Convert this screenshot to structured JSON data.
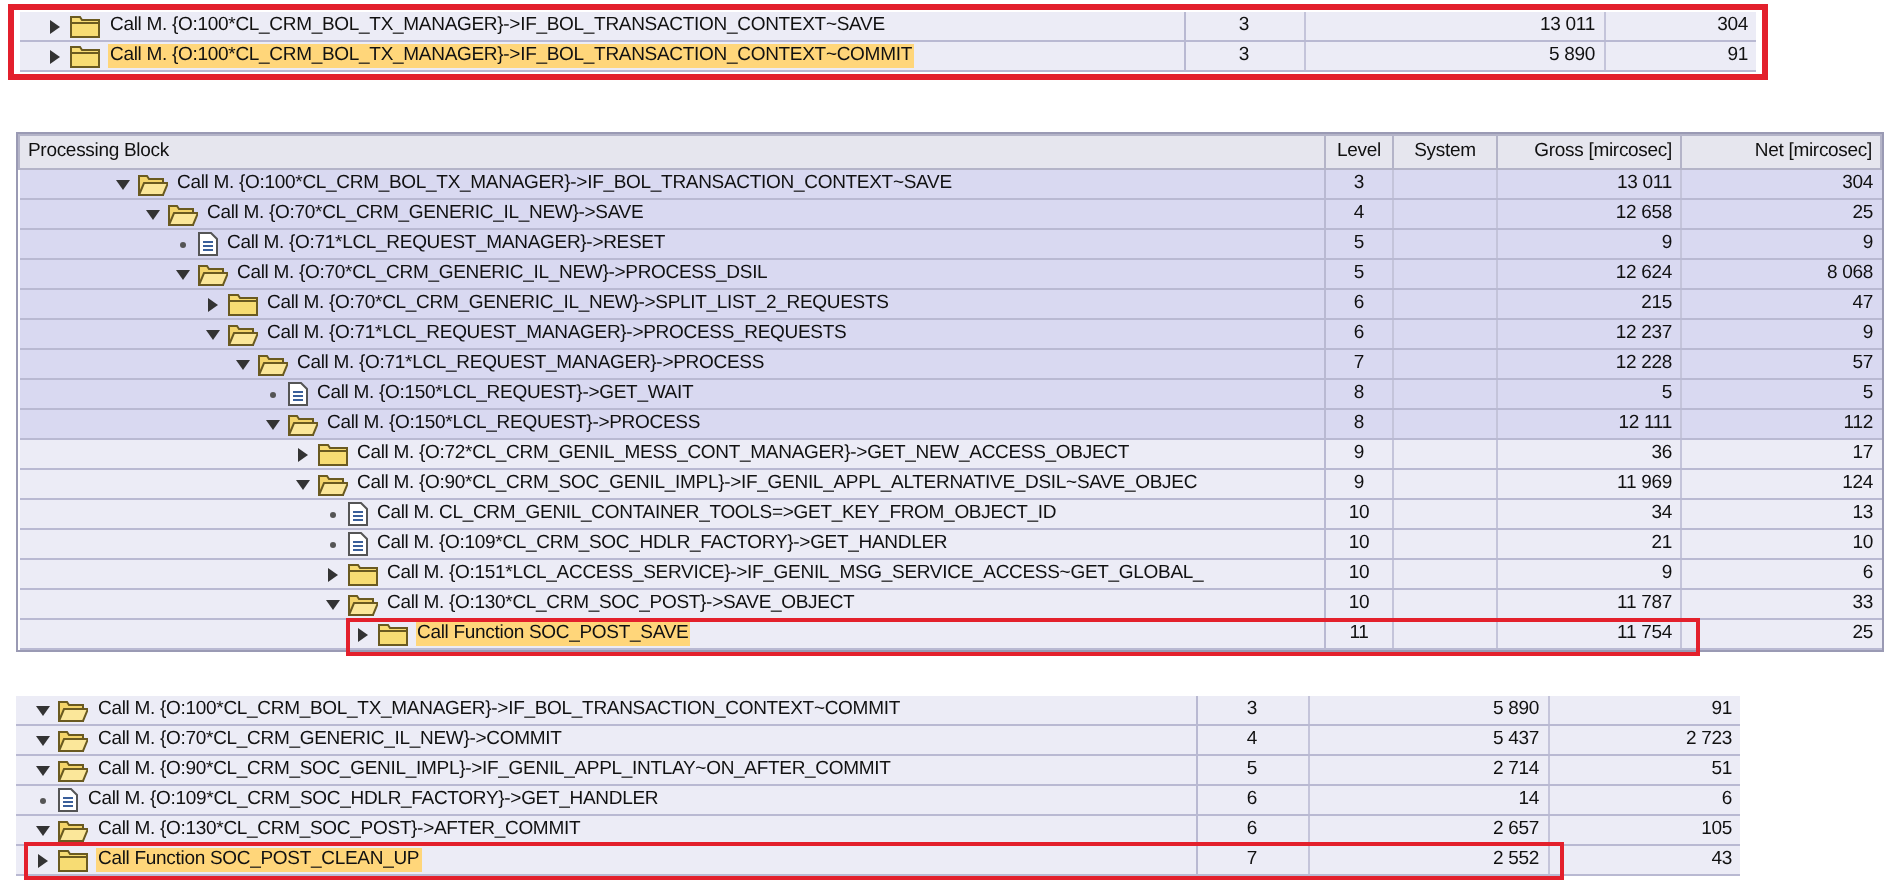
{
  "top_excerpt": {
    "framed": true,
    "rows": [
      {
        "kind": "folder",
        "expanded": false,
        "text": "Call M. {O:100*CL_CRM_BOL_TX_MANAGER}->IF_BOL_TRANSACTION_CONTEXT~SAVE",
        "level": "3",
        "gross": "13 011",
        "net": "304",
        "selected": false,
        "shaded": false,
        "framed": false
      },
      {
        "kind": "folder",
        "expanded": false,
        "text": "Call M. {O:100*CL_CRM_BOL_TX_MANAGER}->IF_BOL_TRANSACTION_CONTEXT~COMMIT",
        "level": "3",
        "gross": "5 890",
        "net": "91",
        "selected": true,
        "shaded": false,
        "framed": false
      }
    ]
  },
  "trace_table": {
    "columns": [
      "Processing Block",
      "Level",
      "System",
      "Gross [mircosec]",
      "Net [mircosec]"
    ],
    "rows": [
      {
        "kind": "folder",
        "expanded": true,
        "text": "Call M. {O:100*CL_CRM_BOL_TX_MANAGER}->IF_BOL_TRANSACTION_CONTEXT~SAVE",
        "level": "3",
        "gross": "13 011",
        "net": "304",
        "selected": false,
        "shaded": true,
        "framed": false,
        "children": [
          {
            "kind": "folder",
            "expanded": true,
            "text": "Call M. {O:70*CL_CRM_GENERIC_IL_NEW}->SAVE",
            "level": "4",
            "gross": "12 658",
            "net": "25",
            "selected": false,
            "shaded": true,
            "framed": false,
            "children": [
              {
                "kind": "document",
                "text": "Call M. {O:71*LCL_REQUEST_MANAGER}->RESET",
                "level": "5",
                "gross": "9",
                "net": "9",
                "selected": false,
                "shaded": true,
                "framed": false
              },
              {
                "kind": "folder",
                "expanded": true,
                "text": "Call M. {O:70*CL_CRM_GENERIC_IL_NEW}->PROCESS_DSIL",
                "level": "5",
                "gross": "12 624",
                "net": "8 068",
                "selected": false,
                "shaded": true,
                "framed": false,
                "children": [
                  {
                    "kind": "folder",
                    "expanded": false,
                    "text": "Call M. {O:70*CL_CRM_GENERIC_IL_NEW}->SPLIT_LIST_2_REQUESTS",
                    "level": "6",
                    "gross": "215",
                    "net": "47",
                    "selected": false,
                    "shaded": true,
                    "framed": false
                  },
                  {
                    "kind": "folder",
                    "expanded": true,
                    "text": "Call M. {O:71*LCL_REQUEST_MANAGER}->PROCESS_REQUESTS",
                    "level": "6",
                    "gross": "12 237",
                    "net": "9",
                    "selected": false,
                    "shaded": true,
                    "framed": false,
                    "children": [
                      {
                        "kind": "folder",
                        "expanded": true,
                        "text": "Call M. {O:71*LCL_REQUEST_MANAGER}->PROCESS",
                        "level": "7",
                        "gross": "12 228",
                        "net": "57",
                        "selected": false,
                        "shaded": true,
                        "framed": false,
                        "children": [
                          {
                            "kind": "document",
                            "text": "Call M. {O:150*LCL_REQUEST}->GET_WAIT",
                            "level": "8",
                            "gross": "5",
                            "net": "5",
                            "selected": false,
                            "shaded": true,
                            "framed": false
                          },
                          {
                            "kind": "folder",
                            "expanded": true,
                            "text": "Call M. {O:150*LCL_REQUEST}->PROCESS",
                            "level": "8",
                            "gross": "12 111",
                            "net": "112",
                            "selected": false,
                            "shaded": true,
                            "framed": false,
                            "children": [
                              {
                                "kind": "folder",
                                "expanded": false,
                                "text": "Call M. {O:72*CL_CRM_GENIL_MESS_CONT_MANAGER}->GET_NEW_ACCESS_OBJECT",
                                "level": "9",
                                "gross": "36",
                                "net": "17",
                                "selected": false,
                                "shaded": false,
                                "framed": false
                              },
                              {
                                "kind": "folder",
                                "expanded": true,
                                "text": "Call M. {O:90*CL_CRM_SOC_GENIL_IMPL}->IF_GENIL_APPL_ALTERNATIVE_DSIL~SAVE_OBJEC",
                                "level": "9",
                                "gross": "11 969",
                                "net": "124",
                                "selected": false,
                                "shaded": false,
                                "framed": false,
                                "children": [
                                  {
                                    "kind": "document",
                                    "text": "Call M. CL_CRM_GENIL_CONTAINER_TOOLS=>GET_KEY_FROM_OBJECT_ID",
                                    "level": "10",
                                    "gross": "34",
                                    "net": "13",
                                    "selected": false,
                                    "shaded": false,
                                    "framed": false
                                  },
                                  {
                                    "kind": "document",
                                    "text": "Call M. {O:109*CL_CRM_SOC_HDLR_FACTORY}->GET_HANDLER",
                                    "level": "10",
                                    "gross": "21",
                                    "net": "10",
                                    "selected": false,
                                    "shaded": false,
                                    "framed": false
                                  },
                                  {
                                    "kind": "folder",
                                    "expanded": false,
                                    "text": "Call M. {O:151*LCL_ACCESS_SERVICE}->IF_GENIL_MSG_SERVICE_ACCESS~GET_GLOBAL_",
                                    "level": "10",
                                    "gross": "9",
                                    "net": "6",
                                    "selected": false,
                                    "shaded": false,
                                    "framed": false
                                  },
                                  {
                                    "kind": "folder",
                                    "expanded": true,
                                    "text": "Call M. {O:130*CL_CRM_SOC_POST}->SAVE_OBJECT",
                                    "level": "10",
                                    "gross": "11 787",
                                    "net": "33",
                                    "selected": false,
                                    "shaded": false,
                                    "framed": false,
                                    "children": [
                                      {
                                        "kind": "folder",
                                        "expanded": false,
                                        "text": "Call Function SOC_POST_SAVE",
                                        "level": "11",
                                        "gross": "11 754",
                                        "net": "25",
                                        "selected": true,
                                        "shaded": false,
                                        "framed": true
                                      }
                                    ]
                                  }
                                ]
                              }
                            ]
                          }
                        ]
                      }
                    ]
                  }
                ]
              }
            ]
          }
        ]
      }
    ]
  },
  "bottom_excerpt": {
    "rows": [
      {
        "kind": "folder",
        "expanded": true,
        "text": "Call M. {O:100*CL_CRM_BOL_TX_MANAGER}->IF_BOL_TRANSACTION_CONTEXT~COMMIT",
        "level": "3",
        "gross": "5 890",
        "net": "91",
        "selected": false,
        "shaded": false,
        "framed": false,
        "children": [
          {
            "kind": "folder",
            "expanded": true,
            "text": "Call M. {O:70*CL_CRM_GENERIC_IL_NEW}->COMMIT",
            "level": "4",
            "gross": "5 437",
            "net": "2 723",
            "selected": false,
            "shaded": false,
            "framed": false,
            "children": [
              {
                "kind": "folder",
                "expanded": true,
                "text": "Call M. {O:90*CL_CRM_SOC_GENIL_IMPL}->IF_GENIL_APPL_INTLAY~ON_AFTER_COMMIT",
                "level": "5",
                "gross": "2 714",
                "net": "51",
                "selected": false,
                "shaded": false,
                "framed": false,
                "children": [
                  {
                    "kind": "document",
                    "text": "Call M. {O:109*CL_CRM_SOC_HDLR_FACTORY}->GET_HANDLER",
                    "level": "6",
                    "gross": "14",
                    "net": "6",
                    "selected": false,
                    "shaded": false,
                    "framed": false
                  },
                  {
                    "kind": "folder",
                    "expanded": true,
                    "text": "Call M. {O:130*CL_CRM_SOC_POST}->AFTER_COMMIT",
                    "level": "6",
                    "gross": "2 657",
                    "net": "105",
                    "selected": false,
                    "shaded": false,
                    "framed": false,
                    "children": [
                      {
                        "kind": "folder",
                        "expanded": false,
                        "text": "Call Function SOC_POST_CLEAN_UP",
                        "level": "7",
                        "gross": "2 552",
                        "net": "43",
                        "selected": true,
                        "shaded": false,
                        "framed": true
                      }
                    ]
                  }
                ]
              }
            ]
          }
        ]
      }
    ]
  }
}
